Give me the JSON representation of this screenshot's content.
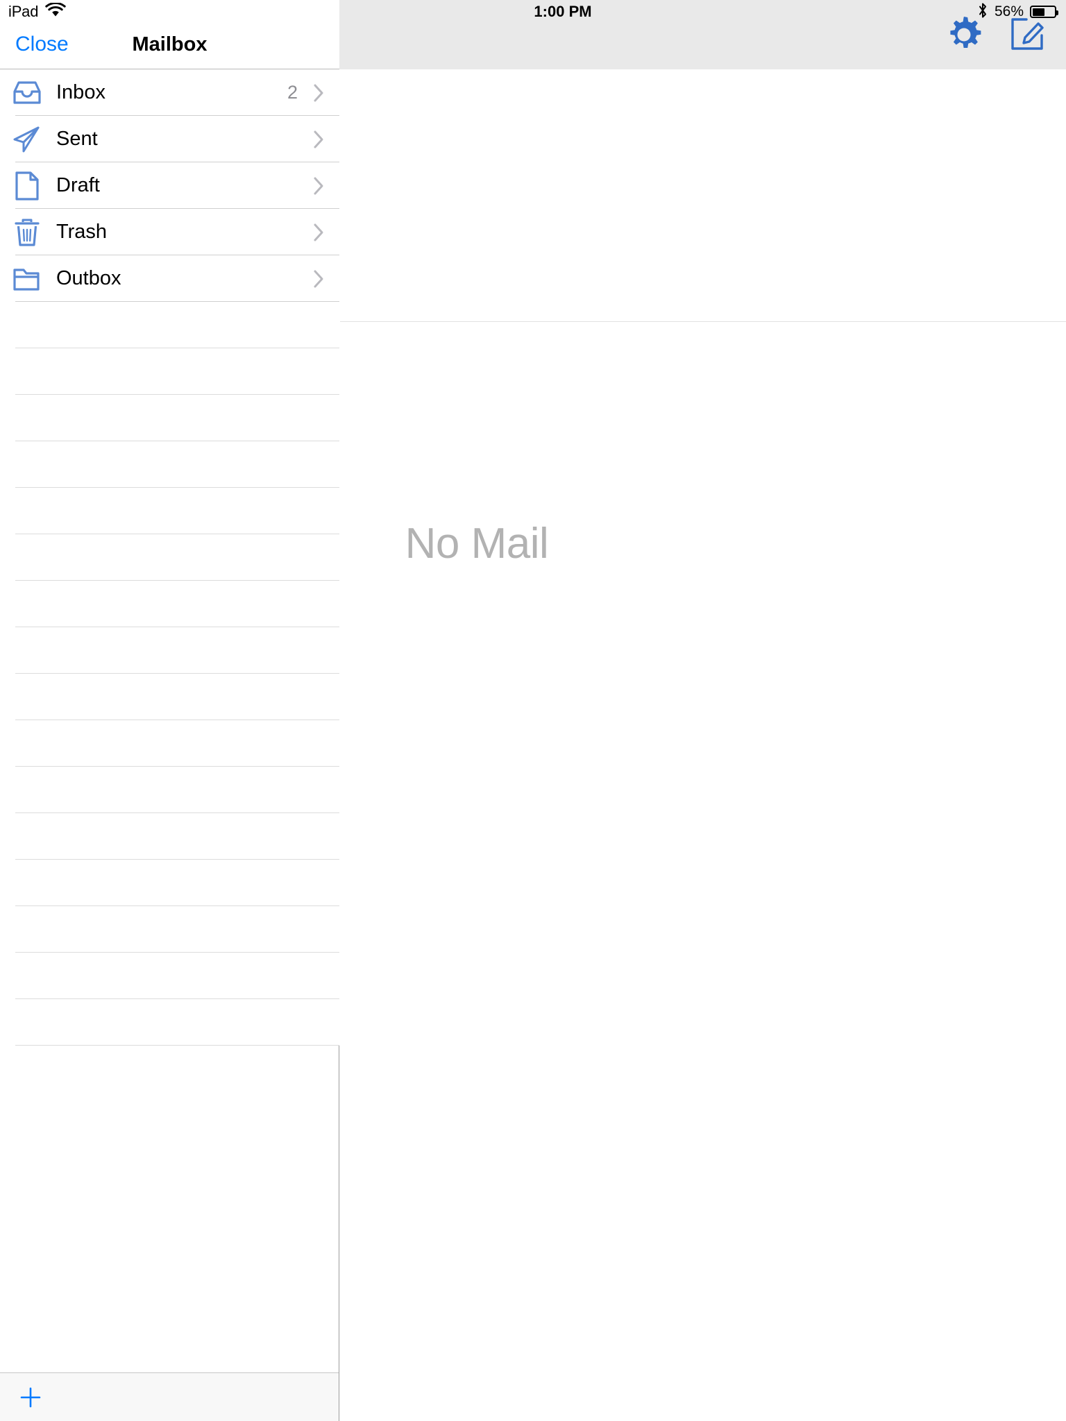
{
  "status_bar": {
    "device": "iPad",
    "wifi_icon": "wifi-icon",
    "time": "1:00 PM",
    "bluetooth_icon": "bluetooth-icon",
    "battery_percent": "56%",
    "battery_level": 56,
    "battery_icon": "battery-icon"
  },
  "colors": {
    "accent_blue": "#007aff",
    "icon_blue": "#5b8ad4",
    "toolbar_blue": "#3b6cb5",
    "toolbar_gray": "#e9e9e9",
    "separator": "#cfcfcf",
    "placeholder_gray": "#b2b2b2"
  },
  "sidebar": {
    "close_label": "Close",
    "title": "Mailbox",
    "add_icon": "plus-icon",
    "items": [
      {
        "label": "Inbox",
        "icon": "inbox-tray-icon",
        "count": "2",
        "chevron": "chevron-right-icon"
      },
      {
        "label": "Sent",
        "icon": "paper-plane-icon",
        "count": "",
        "chevron": "chevron-right-icon"
      },
      {
        "label": "Draft",
        "icon": "document-icon",
        "count": "",
        "chevron": "chevron-right-icon"
      },
      {
        "label": "Trash",
        "icon": "trash-can-icon",
        "count": "",
        "chevron": "chevron-right-icon"
      },
      {
        "label": "Outbox",
        "icon": "folder-icon",
        "count": "",
        "chevron": "chevron-right-icon"
      }
    ],
    "empty_row_count": 16
  },
  "detail": {
    "settings_icon": "gear-icon",
    "compose_icon": "compose-icon",
    "empty_message": "No Mail"
  }
}
